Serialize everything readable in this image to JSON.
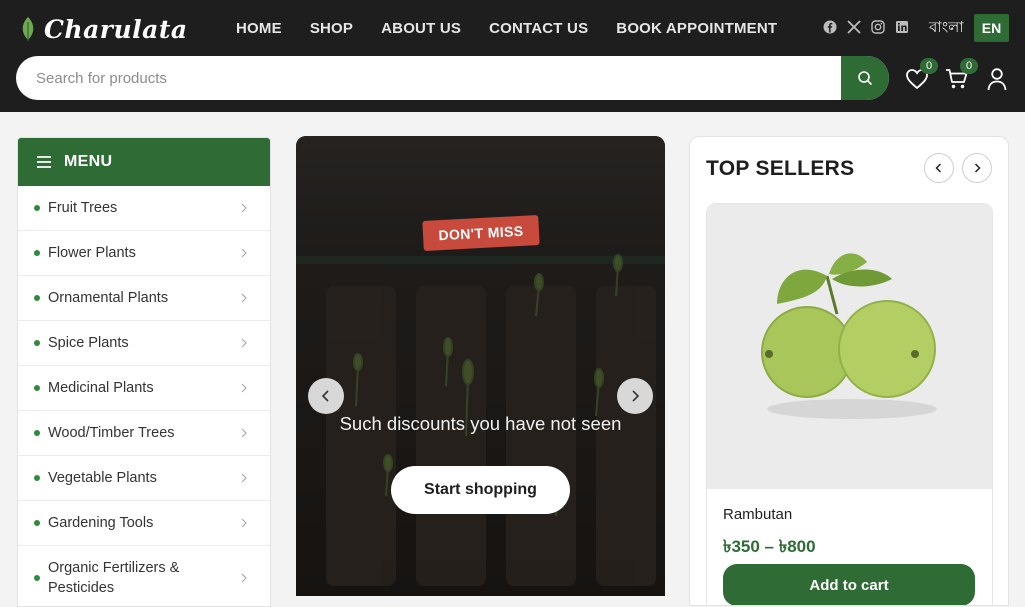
{
  "header": {
    "brand": "Charulata",
    "nav": [
      "HOME",
      "SHOP",
      "ABOUT US",
      "CONTACT US",
      "BOOK APPOINTMENT"
    ],
    "lang_bn": "বাংলা",
    "lang_en": "EN",
    "search_placeholder": "Search for products",
    "wishlist_count": "0",
    "cart_count": "0",
    "social_icons": [
      "facebook-icon",
      "x-icon",
      "instagram-icon",
      "linkedin-icon"
    ]
  },
  "menu": {
    "title": "MENU",
    "items": [
      "Fruit Trees",
      "Flower Plants",
      "Ornamental Plants",
      "Spice Plants",
      "Medicinal Plants",
      "Wood/Timber Trees",
      "Vegetable Plants",
      "Gardening Tools",
      "Organic Fertilizers & Pesticides"
    ]
  },
  "slider": {
    "badge": "DON'T MISS",
    "text": "Such discounts you have not seen",
    "cta": "Start shopping"
  },
  "top_sellers": {
    "title": "TOP SELLERS",
    "product": {
      "name": "Rambutan",
      "price": "৳350 – ৳800",
      "cta": "Add to cart"
    }
  },
  "colors": {
    "brand_green": "#2f6b34",
    "header_bg": "#1e1e1e",
    "badge_red": "#c84a3c"
  }
}
